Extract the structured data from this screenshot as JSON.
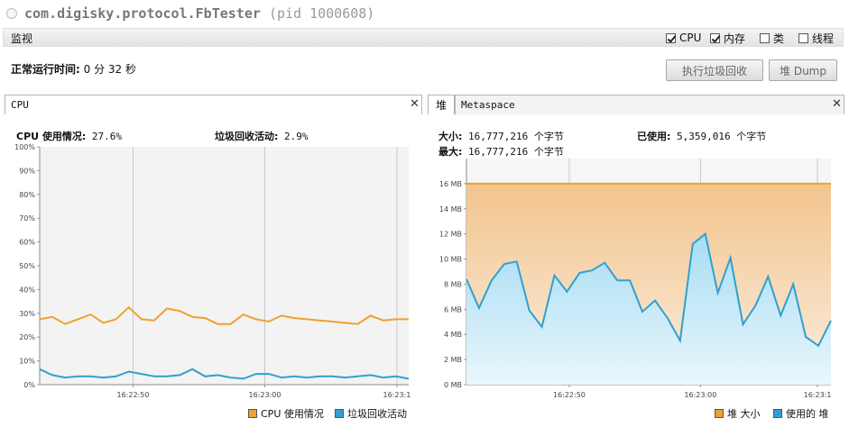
{
  "window": {
    "app_name": "com.digisky.protocol.FbTester",
    "pid_text": "(pid 1000608)"
  },
  "monitor": {
    "label": "监视",
    "checkboxes": [
      {
        "label": "CPU",
        "checked": true
      },
      {
        "label": "内存",
        "checked": true
      },
      {
        "label": "类",
        "checked": false
      },
      {
        "label": "线程",
        "checked": false
      }
    ]
  },
  "uptime": {
    "label": "正常运行时间:",
    "value": "0 分 32 秒"
  },
  "buttons": {
    "gc": "执行垃圾回收",
    "heap_dump": "堆 Dump"
  },
  "cpu_panel": {
    "tab": "CPU",
    "usage_label": "CPU 使用情况:",
    "usage_value": "27.6%",
    "gc_label": "垃圾回收活动:",
    "gc_value": "2.9%"
  },
  "mem_panel": {
    "tabs": [
      "堆",
      "Metaspace"
    ],
    "size_label": "大小:",
    "size_value": "16,777,216 个字节",
    "max_label": "最大:",
    "max_value": "16,777,216 个字节",
    "used_label": "已使用:",
    "used_value": "5,359,016 个字节"
  },
  "chart_data": [
    {
      "type": "line",
      "y_ticks": [
        "0%",
        "10%",
        "20%",
        "30%",
        "40%",
        "50%",
        "60%",
        "70%",
        "80%",
        "90%",
        "100%"
      ],
      "ylim": [
        0,
        100
      ],
      "x_ticks": [
        "16:22:50",
        "16:23:00",
        "16:23:1"
      ],
      "colors": {
        "cpu": "#f0a030",
        "gc": "#30a0d0"
      },
      "series": [
        {
          "name": "CPU 使用情况",
          "values": [
            27.5,
            28.5,
            25.5,
            27.5,
            29.5,
            26,
            27.5,
            32.5,
            27.5,
            27,
            32,
            31,
            28.5,
            28,
            25.5,
            25.5,
            29.5,
            27.5,
            26.5,
            29,
            28,
            27.5,
            27,
            26.5,
            26,
            25.5,
            29,
            27,
            27.5,
            27.5
          ]
        },
        {
          "name": "垃圾回收活动",
          "values": [
            6.5,
            4,
            3,
            3.5,
            3.5,
            3,
            3.5,
            5.5,
            4.5,
            3.5,
            3.5,
            4,
            6.5,
            3.5,
            4,
            3,
            2.5,
            4.5,
            4.5,
            3,
            3.5,
            3,
            3.5,
            3.5,
            3,
            3.5,
            4,
            3,
            3.5,
            2.5
          ]
        }
      ]
    },
    {
      "type": "area",
      "y_ticks": [
        "0 MB",
        "2 MB",
        "4 MB",
        "6 MB",
        "8 MB",
        "10 MB",
        "12 MB",
        "14 MB",
        "16 MB"
      ],
      "ylim": [
        0,
        18
      ],
      "x_ticks": [
        "16:22:50",
        "16:23:00",
        "16:23:1"
      ],
      "colors": {
        "size": "#f0a030",
        "used": "#30a0d0"
      },
      "series": [
        {
          "name": "堆 大小",
          "values": [
            16,
            16,
            16,
            16,
            16,
            16,
            16,
            16,
            16,
            16,
            16,
            16,
            16,
            16,
            16,
            16,
            16,
            16,
            16,
            16,
            16,
            16,
            16,
            16,
            16,
            16,
            16,
            16,
            16,
            16,
            16,
            16
          ]
        },
        {
          "name": "使用的 堆",
          "values": [
            8.4,
            6.1,
            8.3,
            9.6,
            9.8,
            5.9,
            4.6,
            8.7,
            7.4,
            8.9,
            9.1,
            9.7,
            8.3,
            8.3,
            5.8,
            6.7,
            5.3,
            3.5,
            11.2,
            12,
            7.3,
            10.1,
            4.8,
            6.3,
            8.6,
            5.5,
            8,
            3.8,
            3.1,
            5.1
          ]
        }
      ]
    }
  ]
}
